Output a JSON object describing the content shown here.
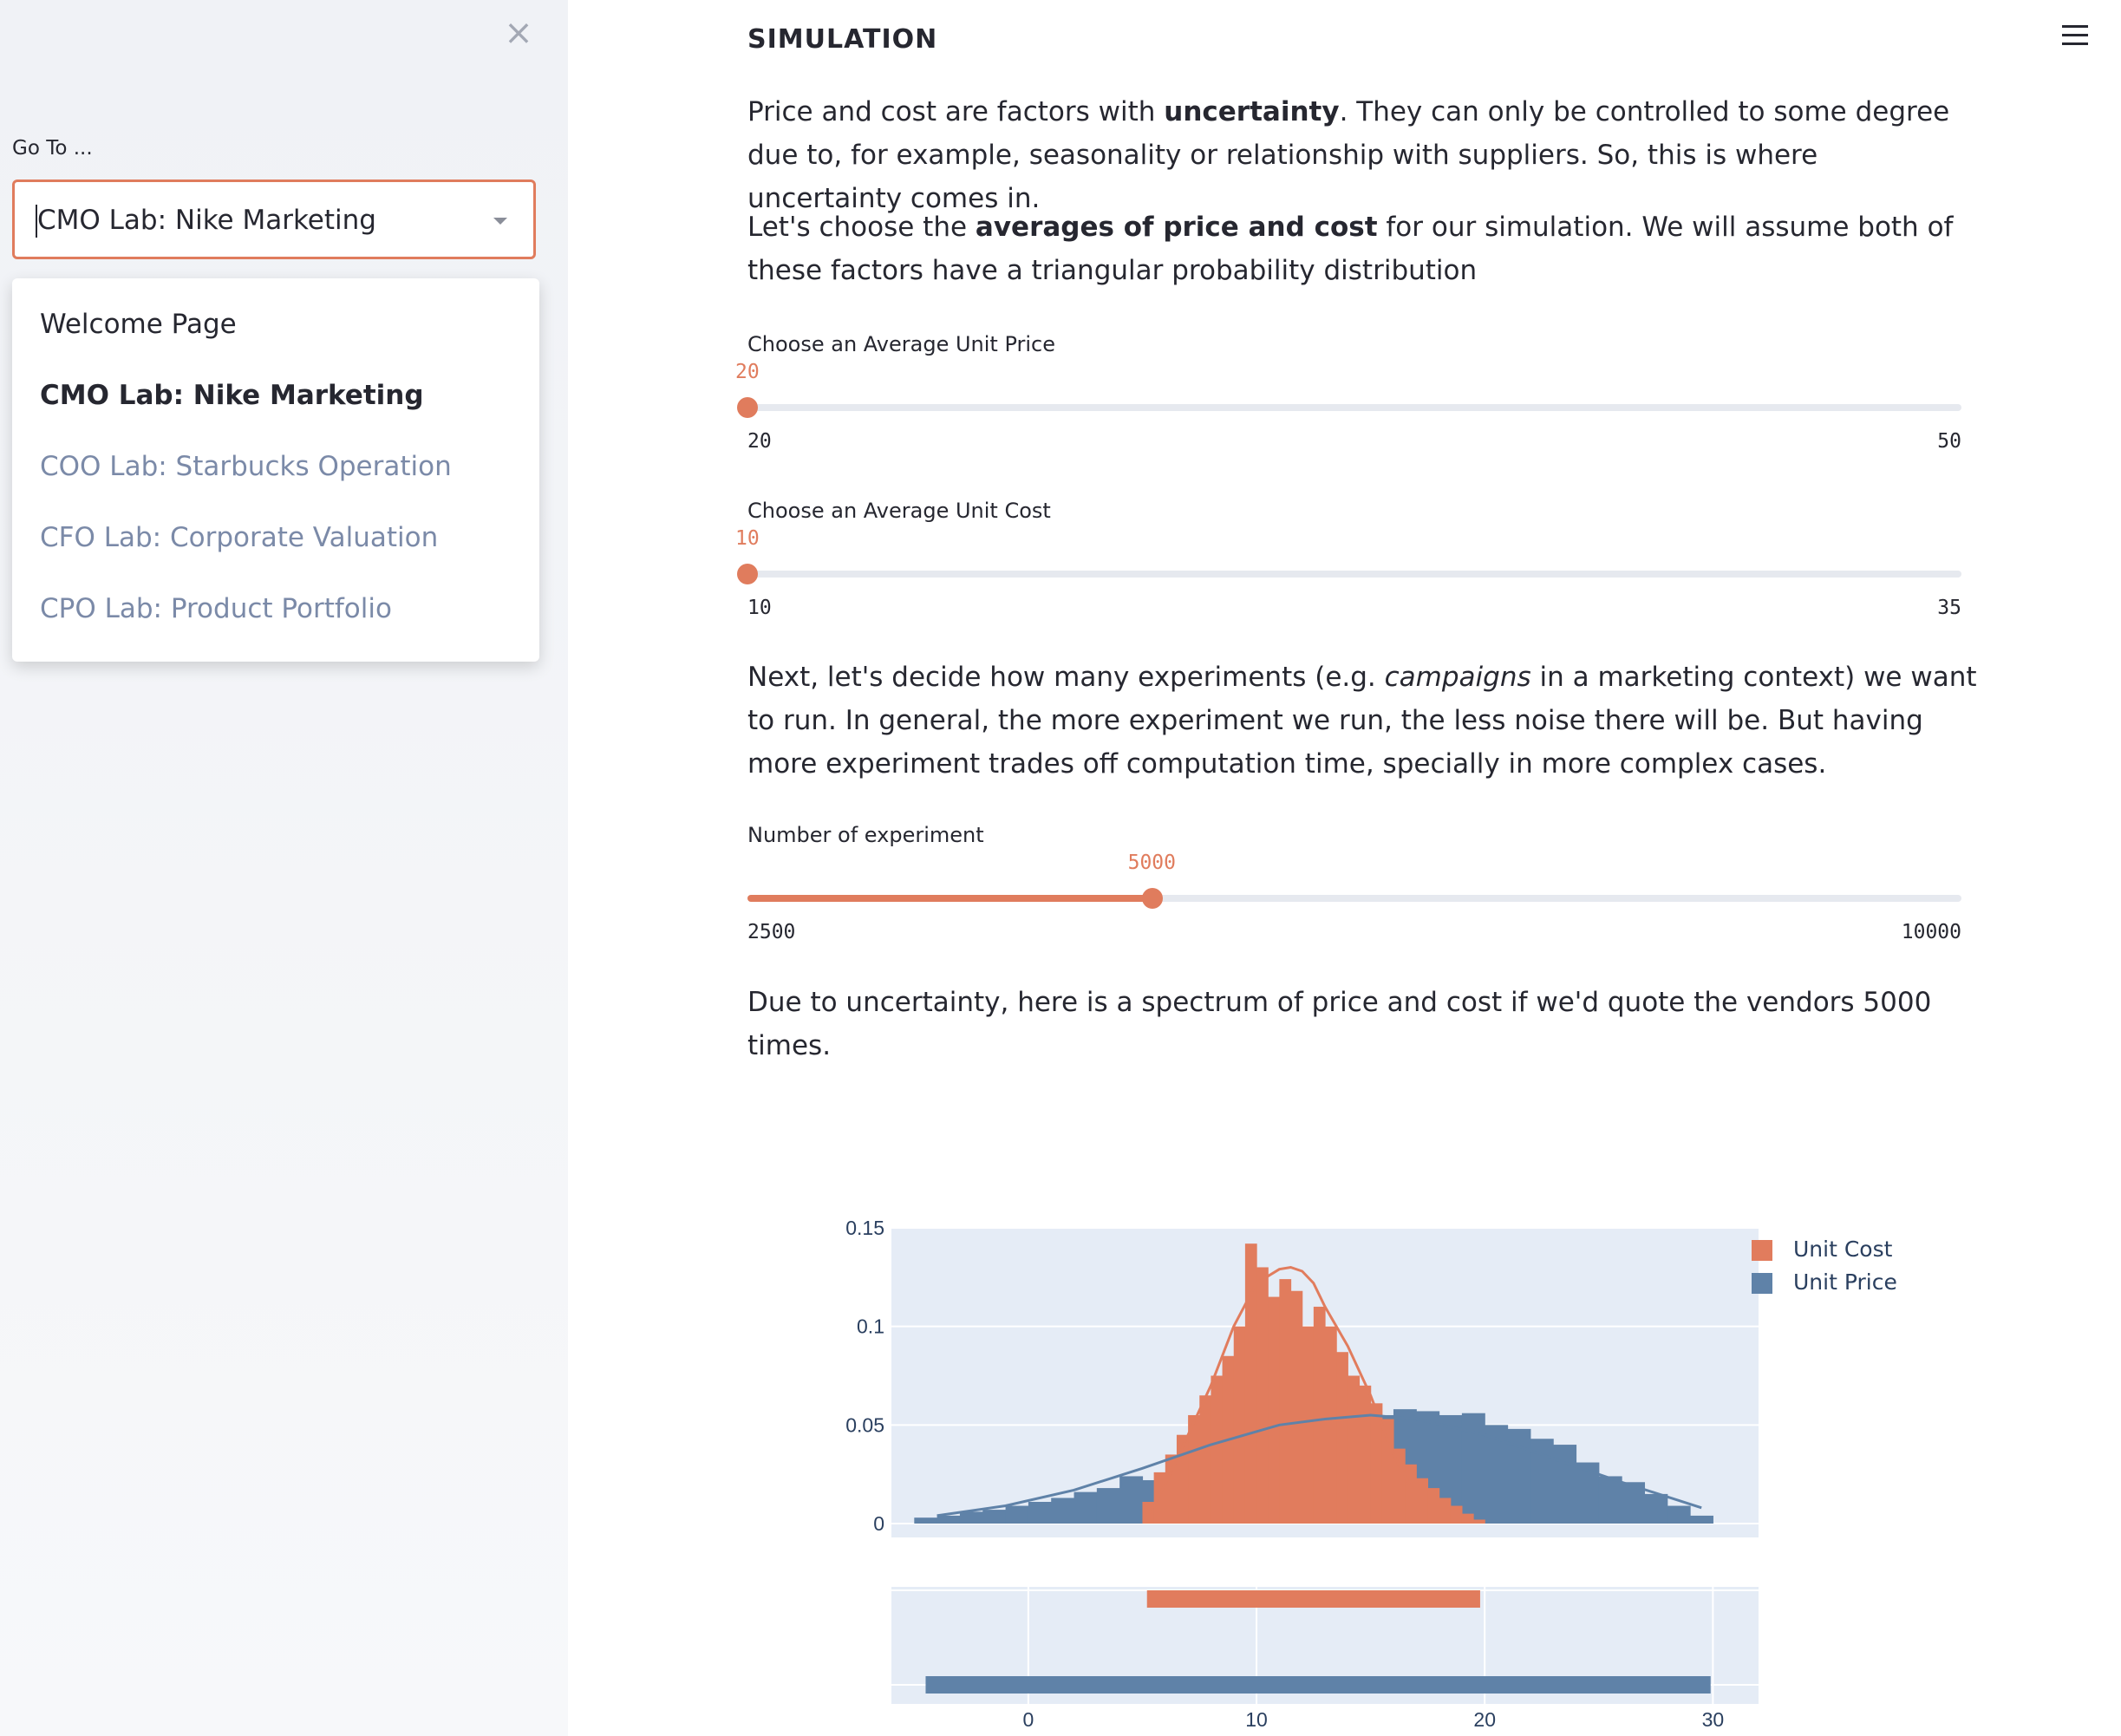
{
  "sidebar": {
    "close_icon": "close-icon",
    "goto_label": "Go To ...",
    "selected_value": "CMO Lab: Nike Marketing",
    "options": [
      {
        "label": "Welcome Page",
        "state": "normal"
      },
      {
        "label": "CMO Lab: Nike Marketing",
        "state": "selected"
      },
      {
        "label": "COO Lab: Starbucks Operation",
        "state": "muted"
      },
      {
        "label": "CFO Lab: Corporate Valuation",
        "state": "muted"
      },
      {
        "label": "CPO Lab: Product Portfolio",
        "state": "muted"
      }
    ]
  },
  "header": {
    "menu_icon": "hamburger-menu-icon"
  },
  "main": {
    "title": "SIMULATION",
    "para1": {
      "pre": "Price and cost are factors with ",
      "bold": "uncertainty",
      "post": ". They can only be controlled to some degree due to, for example, seasonality or relationship with suppliers. So, this is where uncertainty comes in."
    },
    "para2": {
      "pre": "Let's choose the ",
      "bold": "averages of price and cost",
      "post": " for our simulation. We will assume both of these factors have a triangular probability distribution"
    },
    "slider_price": {
      "label": "Choose an Average Unit Price",
      "value": "20",
      "min": "20",
      "max": "50",
      "fraction": 0
    },
    "slider_cost": {
      "label": "Choose an Average Unit Cost",
      "value": "10",
      "min": "10",
      "max": "35",
      "fraction": 0
    },
    "para3": {
      "pre": "Next, let's decide how many experiments (e.g. ",
      "italic": "campaigns",
      "post": " in a marketing context) we want to run. In general, the more experiment we run, the less noise there will be. But having more experiment trades off computation time, specially in more complex cases."
    },
    "slider_experiments": {
      "label": "Number of experiment",
      "value": "5000",
      "min": "2500",
      "max": "10000",
      "fraction": 0.3333
    },
    "para4": "Due to uncertainty, here is a spectrum of price and cost if we'd quote the vendors 5000 times."
  },
  "colors": {
    "accent": "#e07c5d",
    "cost": "#e17c5d",
    "price": "#5f82a8",
    "plot_bg": "#e5ecf6"
  },
  "chart_data": {
    "type": "histogram",
    "title": "",
    "xlabel": "",
    "ylabel": "",
    "x_ticks": [
      "0",
      "10",
      "20",
      "30"
    ],
    "y_ticks": [
      "0",
      "0.05",
      "0.1",
      "0.15"
    ],
    "xlim": [
      -6,
      32
    ],
    "ylim": [
      0,
      0.15
    ],
    "legend_position": "top-right",
    "series": [
      {
        "name": "Unit Cost",
        "color": "#e17c5d",
        "x": [
          5.25,
          5.75,
          6.25,
          6.75,
          7.25,
          7.75,
          8.25,
          8.75,
          9.25,
          9.75,
          10.25,
          10.75,
          11.25,
          11.75,
          12.25,
          12.75,
          13.25,
          13.75,
          14.25,
          14.75,
          15.25,
          15.75,
          16.25,
          16.75,
          17.25,
          17.75,
          18.25,
          18.75,
          19.25,
          19.75
        ],
        "y": [
          0.011,
          0.026,
          0.035,
          0.045,
          0.055,
          0.065,
          0.075,
          0.085,
          0.1,
          0.142,
          0.13,
          0.115,
          0.124,
          0.118,
          0.1,
          0.11,
          0.1,
          0.087,
          0.075,
          0.07,
          0.061,
          0.053,
          0.038,
          0.03,
          0.023,
          0.018,
          0.013,
          0.009,
          0.005,
          0.002
        ]
      },
      {
        "name": "Unit Price",
        "color": "#5f82a8",
        "x": [
          -4.5,
          -3.5,
          -2.5,
          -1.5,
          -0.5,
          0.5,
          1.5,
          2.5,
          3.5,
          4.5,
          5.5,
          6.5,
          7.5,
          8.5,
          9.5,
          10.5,
          11.5,
          12.5,
          13.5,
          14.5,
          15.5,
          16.5,
          17.5,
          18.5,
          19.5,
          20.5,
          21.5,
          22.5,
          23.5,
          24.5,
          25.5,
          26.5,
          27.5,
          28.5,
          29.5
        ],
        "y": [
          0.003,
          0.004,
          0.006,
          0.007,
          0.009,
          0.011,
          0.013,
          0.016,
          0.018,
          0.024,
          0.022,
          0.026,
          0.03,
          0.033,
          0.038,
          0.042,
          0.045,
          0.048,
          0.05,
          0.053,
          0.055,
          0.058,
          0.057,
          0.055,
          0.056,
          0.05,
          0.048,
          0.043,
          0.04,
          0.031,
          0.024,
          0.021,
          0.015,
          0.009,
          0.004
        ]
      }
    ],
    "density_curves": [
      {
        "name": "Unit Cost",
        "x": [
          5.3,
          6,
          7,
          8,
          9,
          10,
          11,
          11.5,
          12,
          12.5,
          13,
          14,
          15,
          16,
          16.7
        ],
        "y": [
          0.005,
          0.02,
          0.045,
          0.07,
          0.1,
          0.122,
          0.129,
          0.13,
          0.128,
          0.122,
          0.11,
          0.09,
          0.065,
          0.035,
          0.02
        ]
      },
      {
        "name": "Unit Price",
        "x": [
          -4,
          -1,
          2,
          5,
          8,
          11,
          13,
          15,
          17,
          20,
          23,
          26,
          29.5
        ],
        "y": [
          0.004,
          0.009,
          0.017,
          0.028,
          0.04,
          0.05,
          0.053,
          0.055,
          0.053,
          0.045,
          0.033,
          0.021,
          0.008
        ]
      }
    ],
    "rug": [
      {
        "name": "Unit Cost",
        "x_range": [
          5.2,
          19.8
        ]
      },
      {
        "name": "Unit Price",
        "x_range": [
          -4.5,
          29.9
        ]
      }
    ]
  }
}
